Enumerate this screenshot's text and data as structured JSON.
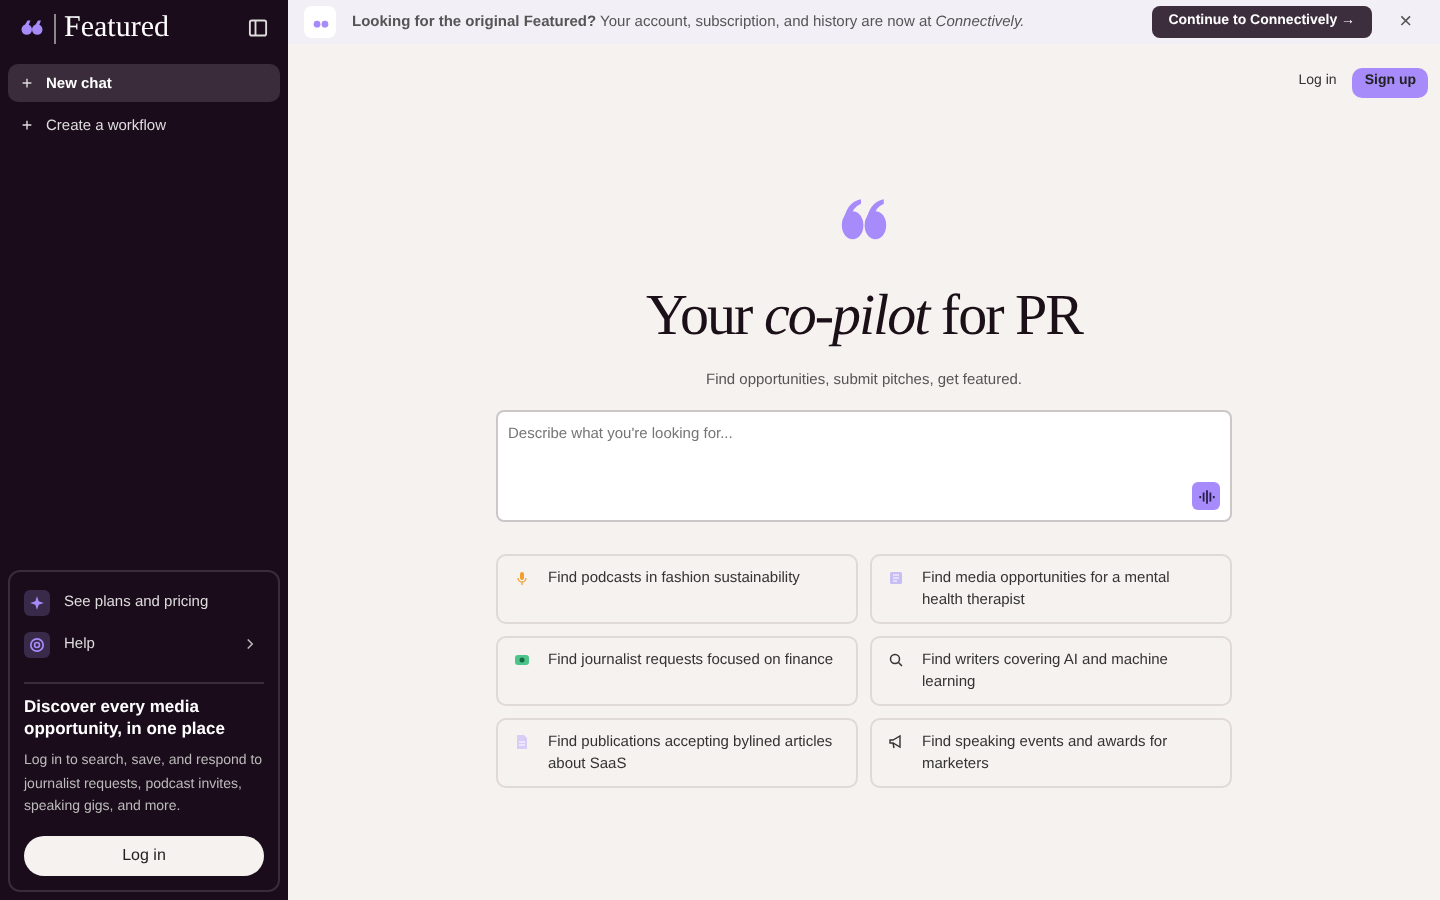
{
  "sidebar": {
    "brand": "Featured",
    "items": [
      {
        "label": "New chat",
        "selected": true
      },
      {
        "label": "Create a workflow",
        "selected": false
      }
    ],
    "links": [
      {
        "label": "See plans and pricing",
        "kind": "link"
      },
      {
        "label": "Help",
        "kind": "submenu"
      }
    ],
    "promo": {
      "title": "Discover every media opportunity, in one place",
      "text": "Log in to search, save, and respond to journalist requests, podcast invites, speaking gigs, and more.",
      "button": "Log in"
    }
  },
  "banner": {
    "text": "**Looking for the original Featured?** Your account, subscription, and history are now at *Connectively.*",
    "button": "Continue to Connectively →",
    "close": "×"
  },
  "header": {
    "login": "Log in",
    "signup": "Sign up"
  },
  "hero": {
    "title": "Your *co-pilot* for PR",
    "subtitle": "Find opportunities, submit pitches, get featured."
  },
  "prompt": {
    "placeholder": "Describe what you're looking for..."
  },
  "suggestions": [
    {
      "text": "Find podcasts in fashion sustainability"
    },
    {
      "text": "Find media opportunities for a mental health therapist"
    },
    {
      "text": "Find journalist requests focused on finance"
    },
    {
      "text": "Find writers covering AI and machine learning"
    },
    {
      "text": "Find publications accepting bylined articles about SaaS"
    },
    {
      "text": "Find speaking events and awards for marketers"
    }
  ]
}
